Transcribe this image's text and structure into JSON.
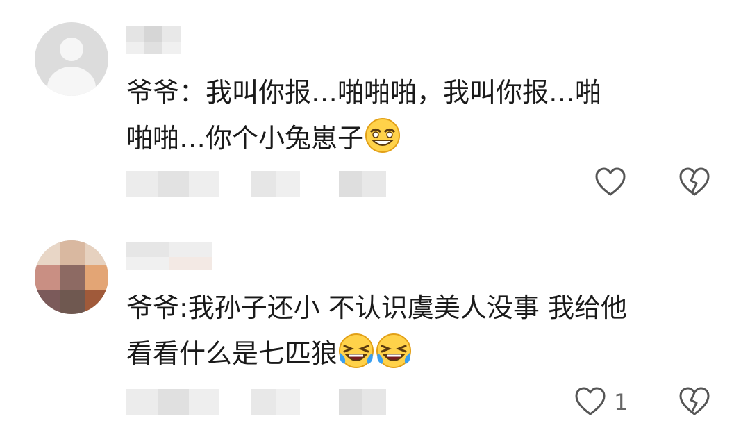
{
  "comments": [
    {
      "text_line1": "爷爷：我叫你报…啪啪啪，我叫你报…啪",
      "text_line2": "啪啪…你个小兔崽子",
      "emojis": [
        "squinting-smile-emoji"
      ],
      "likes": ""
    },
    {
      "text_line1": "爷爷:我孙子还小 不认识虞美人没事 我给他",
      "text_line2": "看看什么是七匹狼",
      "emojis": [
        "crying-laughing-emoji",
        "crying-laughing-emoji"
      ],
      "likes": "1"
    }
  ],
  "icons": {
    "like": "heart-outline-icon",
    "dislike": "broken-heart-icon"
  },
  "colors": {
    "text": "#1a1a1a",
    "icon": "#555555",
    "background": "#ffffff"
  }
}
